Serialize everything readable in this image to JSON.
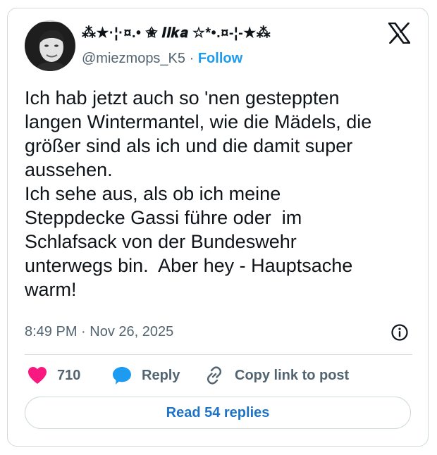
{
  "author": {
    "display_name": "⁂★·¦·¤.• ✬ 𝑰𝒍𝒌𝒂 ☆*•.¤-¦-★⁂",
    "handle": "@miezmops_K5",
    "separator": "·",
    "follow_label": "Follow"
  },
  "tweet": {
    "text": "Ich hab jetzt auch so 'nen gesteppten\nlangen Wintermantel, wie die Mädels, die\ngrößer sind als ich und die damit super\naussehen.\nIch sehe aus, als ob ich meine\nSteppdecke Gassi führe oder  im\nSchlafsack von der Bundeswehr\nunterwegs bin.  Aber hey - Hauptsache\nwarm!",
    "time": "8:49 PM",
    "date_separator": "·",
    "date": "Nov 26, 2025"
  },
  "actions": {
    "likes_count": "710",
    "reply_label": "Reply",
    "copy_link_label": "Copy link to post"
  },
  "replies_button": {
    "label": "Read 54 replies"
  },
  "icons": {
    "logo": "x-logo-icon",
    "info": "info-icon",
    "like": "heart-icon",
    "reply": "speech-bubble-icon",
    "copy": "link-icon"
  },
  "colors": {
    "accent": "#1d9bf0",
    "like": "#f91880",
    "muted": "#536471",
    "border": "#cfd9de",
    "text": "#0f1419"
  }
}
